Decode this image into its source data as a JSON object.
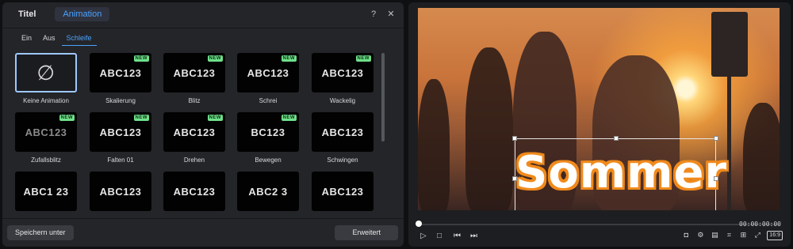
{
  "panel": {
    "tabs": [
      "Titel",
      "Animation"
    ],
    "help_icon": "?",
    "close_icon": "✕",
    "subtabs": [
      "Ein",
      "Aus",
      "Schleife"
    ]
  },
  "animations": [
    {
      "name": "Keine Animation",
      "preview": "∅",
      "new": false
    },
    {
      "name": "Skalierung",
      "preview": "ABC123",
      "new": true
    },
    {
      "name": "Blitz",
      "preview": "ABC123",
      "new": true
    },
    {
      "name": "Schrei",
      "preview": "ABC123",
      "new": true
    },
    {
      "name": "Wackelig",
      "preview": "ABC123",
      "new": true
    },
    {
      "name": "Zufallsblitz",
      "preview": "ABC123",
      "new": true
    },
    {
      "name": "Falten 01",
      "preview": "ABC123",
      "new": true
    },
    {
      "name": "Drehen",
      "preview": "ABC123",
      "new": true
    },
    {
      "name": "Bewegen",
      "preview": "BC123",
      "new": true
    },
    {
      "name": "Schwingen",
      "preview": "ABC123",
      "new": false
    },
    {
      "name": "",
      "preview": "ABC1 23",
      "new": false
    },
    {
      "name": "",
      "preview": "ABC123",
      "new": false
    },
    {
      "name": "",
      "preview": "ABC123",
      "new": false
    },
    {
      "name": "",
      "preview": "ABC2 3",
      "new": false
    },
    {
      "name": "",
      "preview": "ABC123",
      "new": false
    }
  ],
  "new_badge": "NEW",
  "buttons": {
    "save_as": "Speichern unter",
    "advanced": "Erweitert"
  },
  "preview": {
    "title_text": "Sommer",
    "timecode": "00:00:00:00",
    "aspect_ratio": "16:9"
  },
  "colors": {
    "accent": "#4aa3ff",
    "new_badge": "#6fe08a",
    "title_outline": "#f08a1c"
  }
}
